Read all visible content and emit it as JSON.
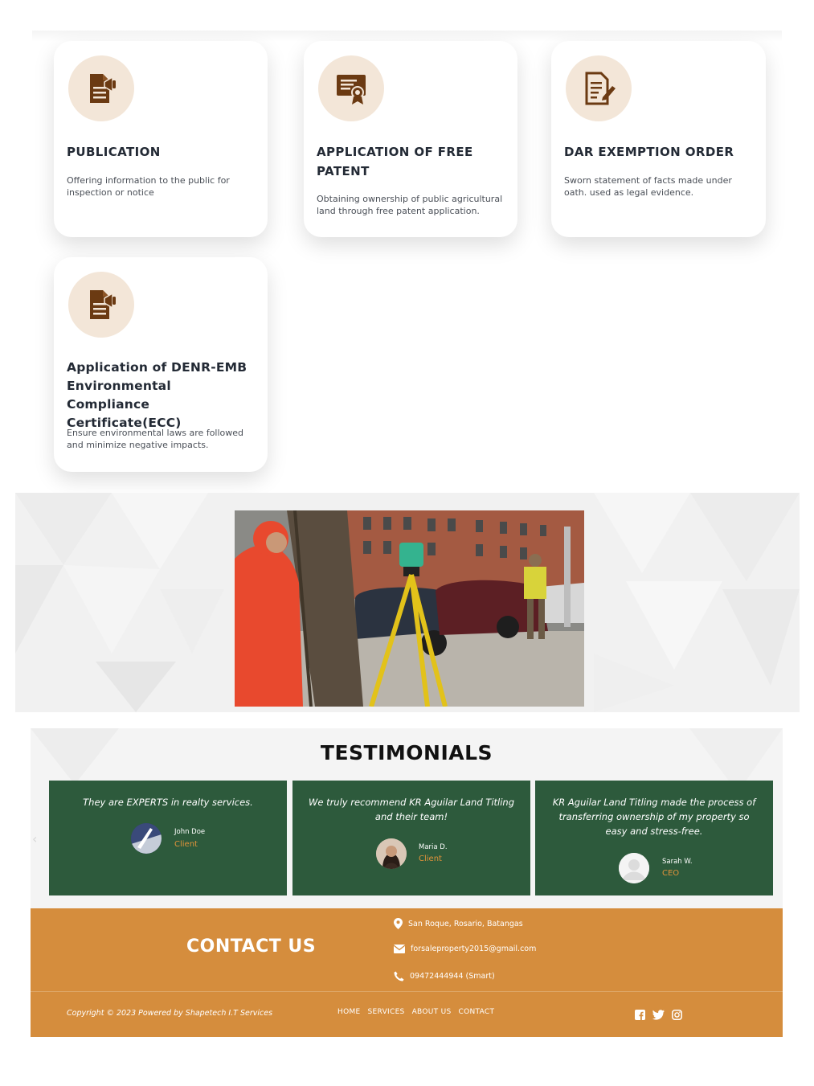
{
  "services": [
    {
      "icon": "document-megaphone-icon",
      "title": "PUBLICATION",
      "description": "Offering information to the public for inspection or notice"
    },
    {
      "icon": "certificate-icon",
      "title": "APPLICATION OF FREE PATENT",
      "description": "Obtaining ownership of public agricultural land through free patent application."
    },
    {
      "icon": "document-pen-icon",
      "title": "DAR EXEMPTION ORDER",
      "description": "Sworn statement of facts made under oath. used as legal evidence."
    },
    {
      "icon": "document-megaphone-icon",
      "title": "Application of DENR-EMB Environmental Compliance Certificate(ECC)",
      "description": "Ensure environmental laws are followed and minimize negative impacts."
    }
  ],
  "testimonials": {
    "title": "TESTIMONIALS",
    "items": [
      {
        "quote": "They are EXPERTS in realty services.",
        "name": "John Doe",
        "role": "Client"
      },
      {
        "quote": "We truly recommend KR Aguilar Land Titling and their team!",
        "name": "Maria D.",
        "role": "Client"
      },
      {
        "quote": "KR Aguilar Land Titling made the process of transferring ownership of my property so easy and stress-free.",
        "name": "Sarah W.",
        "role": "CEO"
      }
    ]
  },
  "contact": {
    "title": "CONTACT US",
    "address": "San Roque, Rosario, Batangas",
    "email": "forsaleproperty2015@gmail.com",
    "phone": "09472444944 (Smart)"
  },
  "footer": {
    "copyright": "Copyright © 2023 Powered by Shapetech I.T Services",
    "nav": [
      "HOME",
      "SERVICES",
      "ABOUT US",
      "CONTACT"
    ],
    "social": [
      "facebook-icon",
      "twitter-icon",
      "instagram-icon"
    ]
  },
  "colors": {
    "accent": "#d58d3d",
    "testimonial_bg": "#2d5a3c",
    "icon_brown": "#6b3a12",
    "icon_circle": "#f3e6d8",
    "role_orange": "#e0923a"
  }
}
